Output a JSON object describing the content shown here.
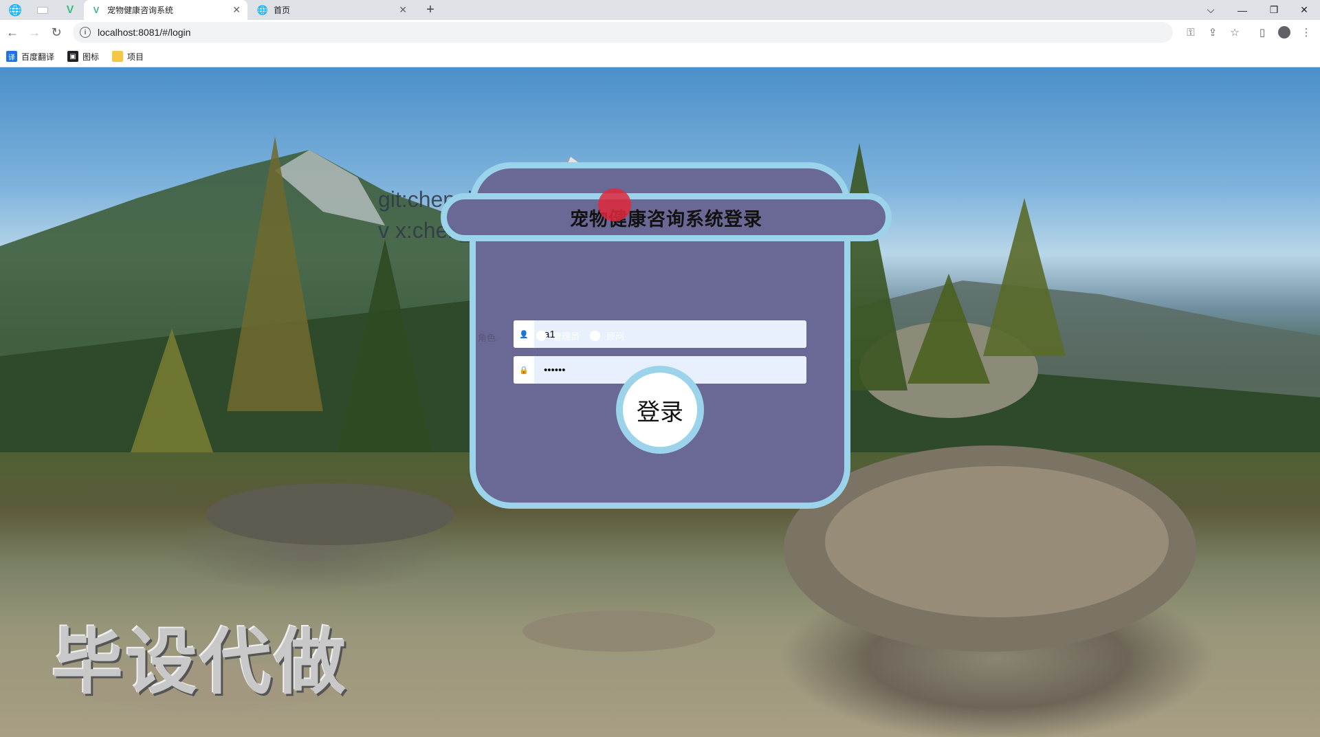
{
  "browser": {
    "tabs": [
      {
        "title": "宠物健康咨询系统",
        "close": "✕",
        "active": true
      },
      {
        "title": "首页",
        "close": "✕",
        "active": false
      }
    ],
    "new_tab": "+",
    "window_controls": {
      "dropdown": "⌵",
      "minimize": "—",
      "restore": "❐",
      "close": "✕"
    },
    "url": "localhost:8081/#/login",
    "bookmarks": [
      {
        "label": "百度翻译",
        "icon": "translate-icon",
        "color": "#1a73e8"
      },
      {
        "label": "图标",
        "icon": "image-icon",
        "color": "#202124"
      },
      {
        "label": "项目",
        "icon": "folder-icon",
        "color": "#f6c744"
      }
    ]
  },
  "watermark": {
    "line1": "git:chenqi199",
    "line2": "v x:chen_q123456",
    "big": "毕设代做"
  },
  "login": {
    "title": "宠物健康咨询系统登录",
    "username_value": "a1",
    "password_value": "••••••",
    "role_label": "角色",
    "roles": [
      "管理员",
      "顾问"
    ],
    "submit_label": "登录"
  },
  "colors": {
    "card_bg": "#6a6894",
    "card_border": "#9bd3ea",
    "field_bg": "#e8f0fe"
  }
}
